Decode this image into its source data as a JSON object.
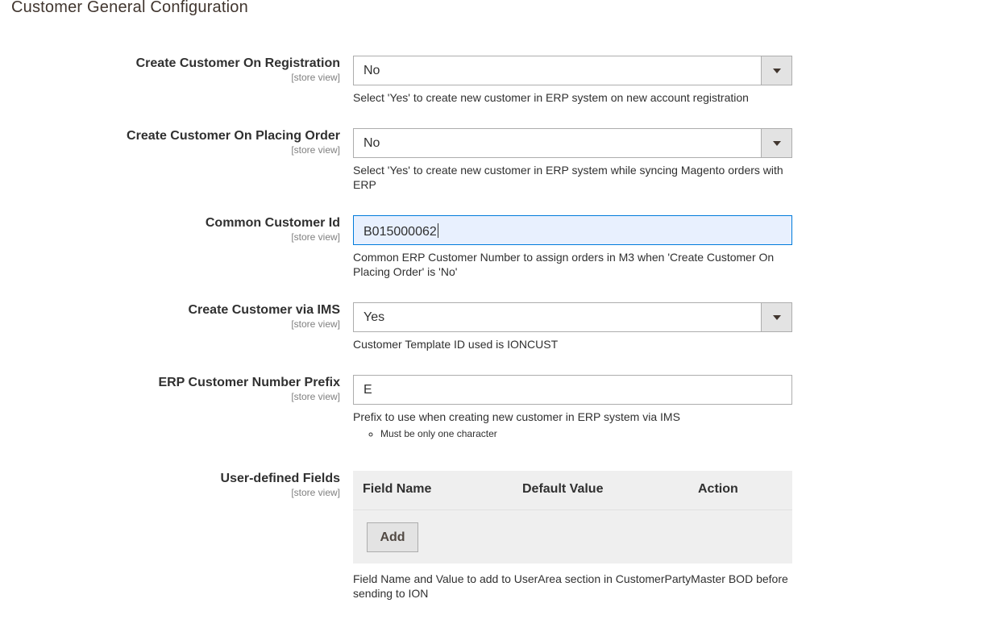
{
  "section": {
    "title": "Customer General Configuration"
  },
  "fields": {
    "create_on_registration": {
      "label": "Create Customer On Registration",
      "scope": "[store view]",
      "value": "No",
      "note": "Select 'Yes' to create new customer in ERP system on new account registration"
    },
    "create_on_placing_order": {
      "label": "Create Customer On Placing Order",
      "scope": "[store view]",
      "value": "No",
      "note": "Select 'Yes' to create new customer in ERP system while syncing Magento orders with ERP"
    },
    "common_customer_id": {
      "label": "Common Customer Id",
      "scope": "[store view]",
      "value": "B015000062",
      "note": "Common ERP Customer Number to assign orders in M3 when 'Create Customer On Placing Order' is 'No'"
    },
    "create_via_ims": {
      "label": "Create Customer via IMS",
      "scope": "[store view]",
      "value": "Yes",
      "note": "Customer Template ID used is IONCUST"
    },
    "erp_prefix": {
      "label": "ERP Customer Number Prefix",
      "scope": "[store view]",
      "value": "E",
      "note": "Prefix to use when creating new customer in ERP system via IMS",
      "note_items": [
        "Must be only one character"
      ]
    },
    "user_defined_fields": {
      "label": "User-defined Fields",
      "scope": "[store view]",
      "columns": [
        "Field Name",
        "Default Value",
        "Action"
      ],
      "add_label": "Add",
      "note": "Field Name and Value to add to UserArea section in CustomerPartyMaster BOD before sending to ION"
    }
  },
  "icons": {
    "dropdown": "chevron-down-icon"
  }
}
